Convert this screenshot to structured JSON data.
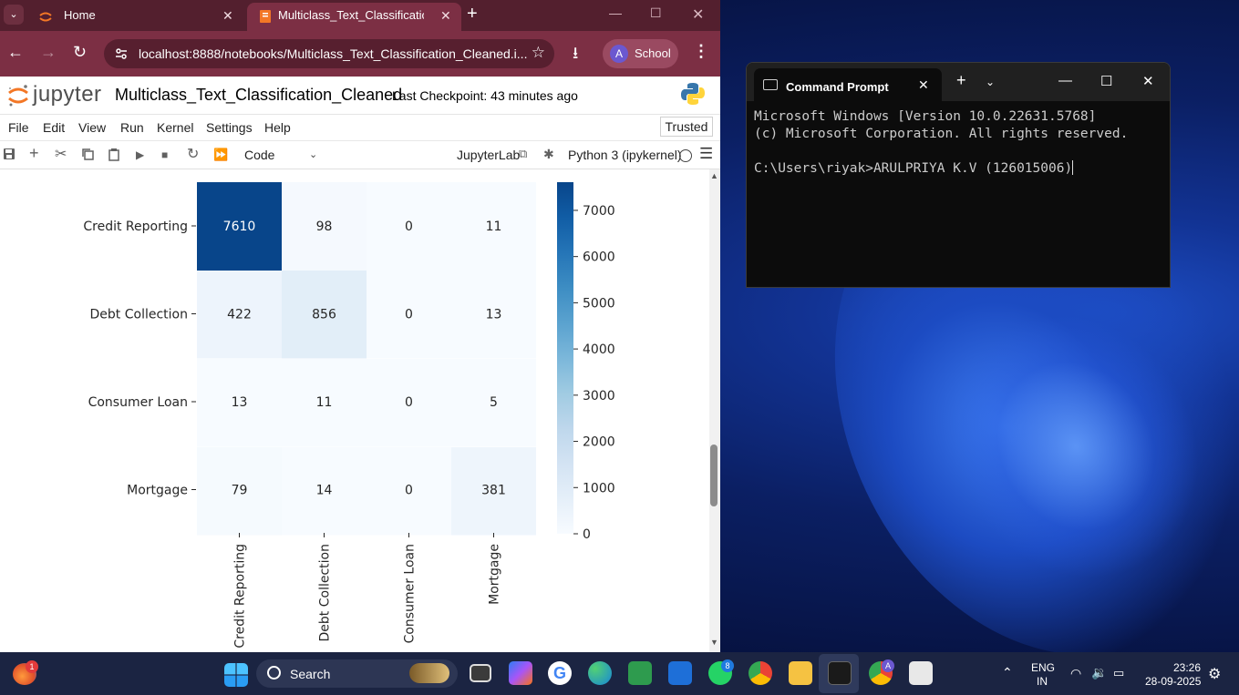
{
  "browser": {
    "tabs": [
      {
        "label": "Home",
        "active": false
      },
      {
        "label": "Multiclass_Text_Classification_Cleaned",
        "active": true
      }
    ],
    "url": "localhost:8888/notebooks/Multiclass_Text_Classification_Cleaned.i...",
    "profile_initial": "A",
    "profile_name": "School"
  },
  "jupyter": {
    "logo_text": "jupyter",
    "notebook_name": "Multiclass_Text_Classification_Cleaned",
    "checkpoint": "Last Checkpoint: 43 minutes ago",
    "menus": [
      "File",
      "Edit",
      "View",
      "Run",
      "Kernel",
      "Settings",
      "Help"
    ],
    "trusted": "Trusted",
    "cell_type": "Code",
    "jupyterlab_link": "JupyterLab",
    "kernel": "Python 3 (ipykernel)"
  },
  "chart_data": {
    "type": "heatmap",
    "rows": [
      "Credit Reporting",
      "Debt Collection",
      "Consumer Loan",
      "Mortgage"
    ],
    "columns": [
      "Credit Reporting",
      "Debt Collection",
      "Consumer Loan",
      "Mortgage"
    ],
    "values": [
      [
        7610,
        98,
        0,
        11
      ],
      [
        422,
        856,
        0,
        13
      ],
      [
        13,
        11,
        0,
        5
      ],
      [
        79,
        14,
        0,
        381
      ]
    ],
    "colorbar_ticks": [
      0,
      1000,
      2000,
      3000,
      4000,
      5000,
      6000,
      7000
    ],
    "colormap": "Blues",
    "vmin": 0,
    "vmax": 7610
  },
  "terminal": {
    "title": "Command Prompt",
    "lines": [
      "Microsoft Windows [Version 10.0.22631.5768]",
      "(c) Microsoft Corporation. All rights reserved.",
      "",
      "C:\\Users\\riyak>ARULPRIYA K.V (126015006)"
    ]
  },
  "taskbar": {
    "search_label": "Search",
    "widget_badge": "1",
    "whatsapp_badge": "8",
    "chrome_profile_badge": "A",
    "language": "ENG",
    "region": "IN",
    "time": "23:26",
    "date": "28-09-2025"
  }
}
